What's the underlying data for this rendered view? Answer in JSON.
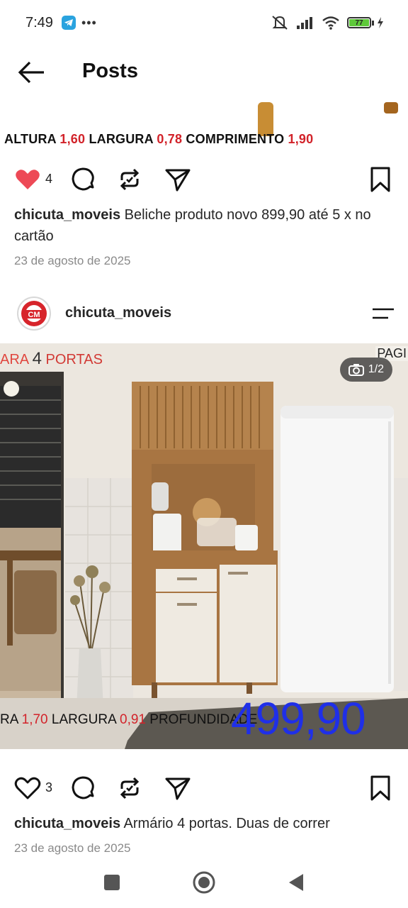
{
  "status_bar": {
    "time": "7:49",
    "overflow_dots": "•••",
    "battery_level": "77",
    "icons": [
      "telegram-icon",
      "mute-icon",
      "signal-icon",
      "wifi-icon",
      "battery-icon",
      "charging-icon"
    ]
  },
  "header": {
    "title": "Posts",
    "back_icon": "arrow-left-icon"
  },
  "post1": {
    "dims": {
      "altura_label": "ALTURA",
      "altura_value": "1,60",
      "largura_label": "LARGURA",
      "largura_value": "0,78",
      "comprimento_label": "COMPRIMENTO",
      "comprimento_value": "1,90"
    },
    "likes": "4",
    "liked": true,
    "username": "chicuta_moveis",
    "caption": "Beliche produto novo 899,90 até 5 x no cartão",
    "date": "23 de agosto de 2025"
  },
  "post2": {
    "username": "chicuta_moveis",
    "avatar_text": "CM",
    "photo_counter": "1/2",
    "banner_left_partial": "ARA",
    "banner_left_number": "4",
    "banner_left_word": "PORTAS",
    "banner_right_partial": "PAGI",
    "dims": {
      "prefix": "RA",
      "altura_value": "1,70",
      "largura_label": "LARGURA",
      "largura_value": "0,91",
      "profundidade_label": "PROFUNDIDADE"
    },
    "price": "499,90",
    "likes": "3",
    "liked": false,
    "caption": "Armário 4 portas. Duas de correr",
    "date": "23 de agosto de 2025"
  },
  "colors": {
    "like_red": "#ed4956",
    "dim_red": "#d2232a",
    "price_blue": "#1f2fe8",
    "text_dark": "#262626",
    "text_gray": "#8a8a8a"
  }
}
